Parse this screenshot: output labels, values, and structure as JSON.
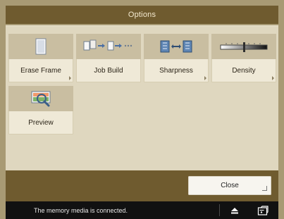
{
  "window": {
    "title": "Options"
  },
  "options": [
    {
      "label": "Erase Frame",
      "icon": "page-icon",
      "has_submenu": true
    },
    {
      "label": "Job Build",
      "icon": "job-build-icon",
      "has_submenu": false
    },
    {
      "label": "Sharpness",
      "icon": "sharpness-icon",
      "has_submenu": true
    },
    {
      "label": "Density",
      "icon": "density-slider-icon",
      "has_submenu": true
    },
    {
      "label": "Preview",
      "icon": "preview-magnifier-icon",
      "has_submenu": false
    }
  ],
  "footer": {
    "close_label": "Close"
  },
  "status": {
    "message": "The memory media is connected."
  },
  "colors": {
    "header_bg": "#6f5b2f",
    "panel_bg": "#dfd7bf",
    "tile_bg": "#efe9d7",
    "icon_band_bg": "#c9bea1",
    "status_bg": "#111111"
  }
}
